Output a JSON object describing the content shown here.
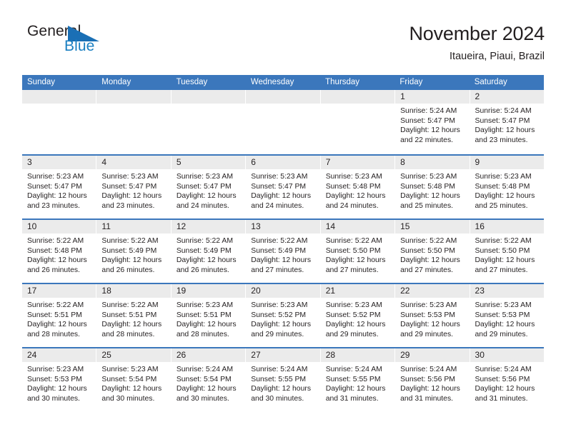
{
  "logo": {
    "word1": "General",
    "word2": "Blue",
    "mark": "triangle-mark",
    "color_dark": "#231f20",
    "color_blue": "#1a7fc1"
  },
  "header": {
    "title": "November 2024",
    "subtitle": "Itaueira, Piaui, Brazil"
  },
  "theme": {
    "header_blue": "#3b77bc",
    "daynum_band": "#ebebeb",
    "text": "#231f20"
  },
  "weekdays": [
    "Sunday",
    "Monday",
    "Tuesday",
    "Wednesday",
    "Thursday",
    "Friday",
    "Saturday"
  ],
  "weeks": [
    [
      {
        "day": "",
        "empty": true
      },
      {
        "day": "",
        "empty": true
      },
      {
        "day": "",
        "empty": true
      },
      {
        "day": "",
        "empty": true
      },
      {
        "day": "",
        "empty": true
      },
      {
        "day": "1",
        "sunrise": "Sunrise: 5:24 AM",
        "sunset": "Sunset: 5:47 PM",
        "daylight1": "Daylight: 12 hours",
        "daylight2": "and 22 minutes."
      },
      {
        "day": "2",
        "sunrise": "Sunrise: 5:24 AM",
        "sunset": "Sunset: 5:47 PM",
        "daylight1": "Daylight: 12 hours",
        "daylight2": "and 23 minutes."
      }
    ],
    [
      {
        "day": "3",
        "sunrise": "Sunrise: 5:23 AM",
        "sunset": "Sunset: 5:47 PM",
        "daylight1": "Daylight: 12 hours",
        "daylight2": "and 23 minutes."
      },
      {
        "day": "4",
        "sunrise": "Sunrise: 5:23 AM",
        "sunset": "Sunset: 5:47 PM",
        "daylight1": "Daylight: 12 hours",
        "daylight2": "and 23 minutes."
      },
      {
        "day": "5",
        "sunrise": "Sunrise: 5:23 AM",
        "sunset": "Sunset: 5:47 PM",
        "daylight1": "Daylight: 12 hours",
        "daylight2": "and 24 minutes."
      },
      {
        "day": "6",
        "sunrise": "Sunrise: 5:23 AM",
        "sunset": "Sunset: 5:47 PM",
        "daylight1": "Daylight: 12 hours",
        "daylight2": "and 24 minutes."
      },
      {
        "day": "7",
        "sunrise": "Sunrise: 5:23 AM",
        "sunset": "Sunset: 5:48 PM",
        "daylight1": "Daylight: 12 hours",
        "daylight2": "and 24 minutes."
      },
      {
        "day": "8",
        "sunrise": "Sunrise: 5:23 AM",
        "sunset": "Sunset: 5:48 PM",
        "daylight1": "Daylight: 12 hours",
        "daylight2": "and 25 minutes."
      },
      {
        "day": "9",
        "sunrise": "Sunrise: 5:23 AM",
        "sunset": "Sunset: 5:48 PM",
        "daylight1": "Daylight: 12 hours",
        "daylight2": "and 25 minutes."
      }
    ],
    [
      {
        "day": "10",
        "sunrise": "Sunrise: 5:22 AM",
        "sunset": "Sunset: 5:48 PM",
        "daylight1": "Daylight: 12 hours",
        "daylight2": "and 26 minutes."
      },
      {
        "day": "11",
        "sunrise": "Sunrise: 5:22 AM",
        "sunset": "Sunset: 5:49 PM",
        "daylight1": "Daylight: 12 hours",
        "daylight2": "and 26 minutes."
      },
      {
        "day": "12",
        "sunrise": "Sunrise: 5:22 AM",
        "sunset": "Sunset: 5:49 PM",
        "daylight1": "Daylight: 12 hours",
        "daylight2": "and 26 minutes."
      },
      {
        "day": "13",
        "sunrise": "Sunrise: 5:22 AM",
        "sunset": "Sunset: 5:49 PM",
        "daylight1": "Daylight: 12 hours",
        "daylight2": "and 27 minutes."
      },
      {
        "day": "14",
        "sunrise": "Sunrise: 5:22 AM",
        "sunset": "Sunset: 5:50 PM",
        "daylight1": "Daylight: 12 hours",
        "daylight2": "and 27 minutes."
      },
      {
        "day": "15",
        "sunrise": "Sunrise: 5:22 AM",
        "sunset": "Sunset: 5:50 PM",
        "daylight1": "Daylight: 12 hours",
        "daylight2": "and 27 minutes."
      },
      {
        "day": "16",
        "sunrise": "Sunrise: 5:22 AM",
        "sunset": "Sunset: 5:50 PM",
        "daylight1": "Daylight: 12 hours",
        "daylight2": "and 27 minutes."
      }
    ],
    [
      {
        "day": "17",
        "sunrise": "Sunrise: 5:22 AM",
        "sunset": "Sunset: 5:51 PM",
        "daylight1": "Daylight: 12 hours",
        "daylight2": "and 28 minutes."
      },
      {
        "day": "18",
        "sunrise": "Sunrise: 5:22 AM",
        "sunset": "Sunset: 5:51 PM",
        "daylight1": "Daylight: 12 hours",
        "daylight2": "and 28 minutes."
      },
      {
        "day": "19",
        "sunrise": "Sunrise: 5:23 AM",
        "sunset": "Sunset: 5:51 PM",
        "daylight1": "Daylight: 12 hours",
        "daylight2": "and 28 minutes."
      },
      {
        "day": "20",
        "sunrise": "Sunrise: 5:23 AM",
        "sunset": "Sunset: 5:52 PM",
        "daylight1": "Daylight: 12 hours",
        "daylight2": "and 29 minutes."
      },
      {
        "day": "21",
        "sunrise": "Sunrise: 5:23 AM",
        "sunset": "Sunset: 5:52 PM",
        "daylight1": "Daylight: 12 hours",
        "daylight2": "and 29 minutes."
      },
      {
        "day": "22",
        "sunrise": "Sunrise: 5:23 AM",
        "sunset": "Sunset: 5:53 PM",
        "daylight1": "Daylight: 12 hours",
        "daylight2": "and 29 minutes."
      },
      {
        "day": "23",
        "sunrise": "Sunrise: 5:23 AM",
        "sunset": "Sunset: 5:53 PM",
        "daylight1": "Daylight: 12 hours",
        "daylight2": "and 29 minutes."
      }
    ],
    [
      {
        "day": "24",
        "sunrise": "Sunrise: 5:23 AM",
        "sunset": "Sunset: 5:53 PM",
        "daylight1": "Daylight: 12 hours",
        "daylight2": "and 30 minutes."
      },
      {
        "day": "25",
        "sunrise": "Sunrise: 5:23 AM",
        "sunset": "Sunset: 5:54 PM",
        "daylight1": "Daylight: 12 hours",
        "daylight2": "and 30 minutes."
      },
      {
        "day": "26",
        "sunrise": "Sunrise: 5:24 AM",
        "sunset": "Sunset: 5:54 PM",
        "daylight1": "Daylight: 12 hours",
        "daylight2": "and 30 minutes."
      },
      {
        "day": "27",
        "sunrise": "Sunrise: 5:24 AM",
        "sunset": "Sunset: 5:55 PM",
        "daylight1": "Daylight: 12 hours",
        "daylight2": "and 30 minutes."
      },
      {
        "day": "28",
        "sunrise": "Sunrise: 5:24 AM",
        "sunset": "Sunset: 5:55 PM",
        "daylight1": "Daylight: 12 hours",
        "daylight2": "and 31 minutes."
      },
      {
        "day": "29",
        "sunrise": "Sunrise: 5:24 AM",
        "sunset": "Sunset: 5:56 PM",
        "daylight1": "Daylight: 12 hours",
        "daylight2": "and 31 minutes."
      },
      {
        "day": "30",
        "sunrise": "Sunrise: 5:24 AM",
        "sunset": "Sunset: 5:56 PM",
        "daylight1": "Daylight: 12 hours",
        "daylight2": "and 31 minutes."
      }
    ]
  ]
}
